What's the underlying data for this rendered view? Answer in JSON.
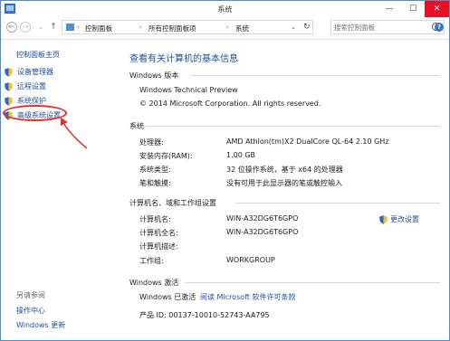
{
  "window": {
    "title": "系统",
    "min_glyph": "—",
    "max_glyph": "☐",
    "close_glyph": "✕"
  },
  "nav": {
    "back_glyph": "←",
    "forward_glyph": "→",
    "down_glyph": "⌄",
    "up_glyph": "↑",
    "breadcrumbs": [
      "控制面板",
      "所有控制面板项",
      "系统"
    ],
    "separator": "›",
    "addr_dropdown": "⌄",
    "refresh_glyph": "↻",
    "search_placeholder": "搜索控制面板"
  },
  "help_glyph": "?",
  "sidebar": {
    "home": "控制面板主页",
    "items": [
      {
        "label": "设备管理器",
        "icon": "shield-icon"
      },
      {
        "label": "远程设置",
        "icon": "shield-icon"
      },
      {
        "label": "系统保护",
        "icon": "shield-icon"
      },
      {
        "label": "高级系统设置",
        "icon": "shield-icon"
      }
    ],
    "see_also": "另请参阅",
    "links": [
      "操作中心",
      "Windows 更新"
    ]
  },
  "main": {
    "heading": "查看有关计算机的基本信息",
    "edition": {
      "section": "Windows 版本",
      "name": "Windows Technical Preview",
      "copyright": "© 2014 Microsoft Corporation. All rights reserved."
    },
    "system": {
      "section": "系统",
      "rows": [
        {
          "key": "处理器:",
          "value": "AMD Athlon(tm)X2 DualCore QL-64   2.10 GHz"
        },
        {
          "key": "安装内存(RAM):",
          "value": "1.00 GB"
        },
        {
          "key": "系统类型:",
          "value": "32 位操作系统，基于 x64 的处理器"
        },
        {
          "key": "笔和触摸:",
          "value": "没有可用于此显示器的笔或触控输入"
        }
      ]
    },
    "computer": {
      "section": "计算机名、域和工作组设置",
      "rows": [
        {
          "key": "计算机名:",
          "value": "WIN-A32DG6T6GPO"
        },
        {
          "key": "计算机全名:",
          "value": "WIN-A32DG6T6GPO"
        },
        {
          "key": "计算机描述:",
          "value": ""
        },
        {
          "key": "工作组:",
          "value": "WORKGROUP"
        }
      ],
      "change_label": "更改设置"
    },
    "activation": {
      "section": "Windows 激活",
      "status": "Windows 已激活",
      "terms_link": "阅读 Microsoft 软件许可条款",
      "product_id": "产品 ID: 00137-10010-52743-AA795"
    }
  },
  "colors": {
    "link": "#1e4fa3",
    "annotation": "#e53030",
    "close": "#e81123"
  }
}
